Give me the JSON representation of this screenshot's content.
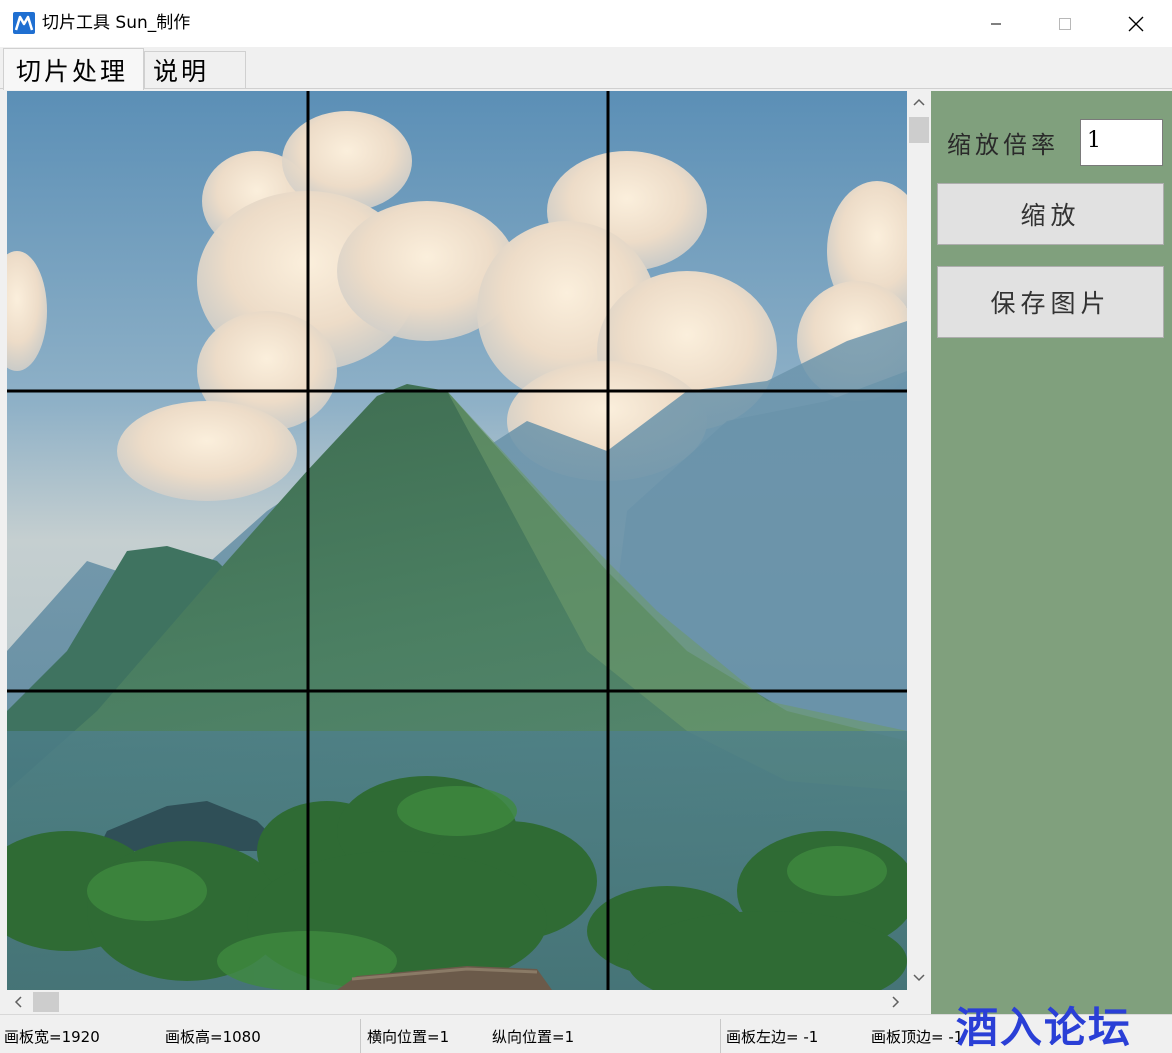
{
  "window": {
    "title": "切片工具  Sun_制作",
    "app_icon": "app-logo-icon",
    "controls": [
      "minimize-icon",
      "maximize-icon",
      "close-icon"
    ]
  },
  "tabs": [
    {
      "label": "切片处理",
      "active": true
    },
    {
      "label": "说明",
      "active": false
    }
  ],
  "canvas": {
    "content": "landscape image",
    "grid": {
      "rows": 3,
      "cols": 3,
      "color": "#000000"
    }
  },
  "side_panel": {
    "background": "#80a07d",
    "zoom_label": "缩放倍率",
    "zoom_value": "1",
    "zoom_button": "缩放",
    "save_button": "保存图片"
  },
  "status": {
    "width": "画板宽=1920",
    "height": "画板高=1080",
    "h_pos": "横向位置=1",
    "v_pos": "纵向位置=1",
    "left": "画板左边= -1",
    "top": "画板顶边= -1"
  },
  "watermark": "酒入论坛"
}
